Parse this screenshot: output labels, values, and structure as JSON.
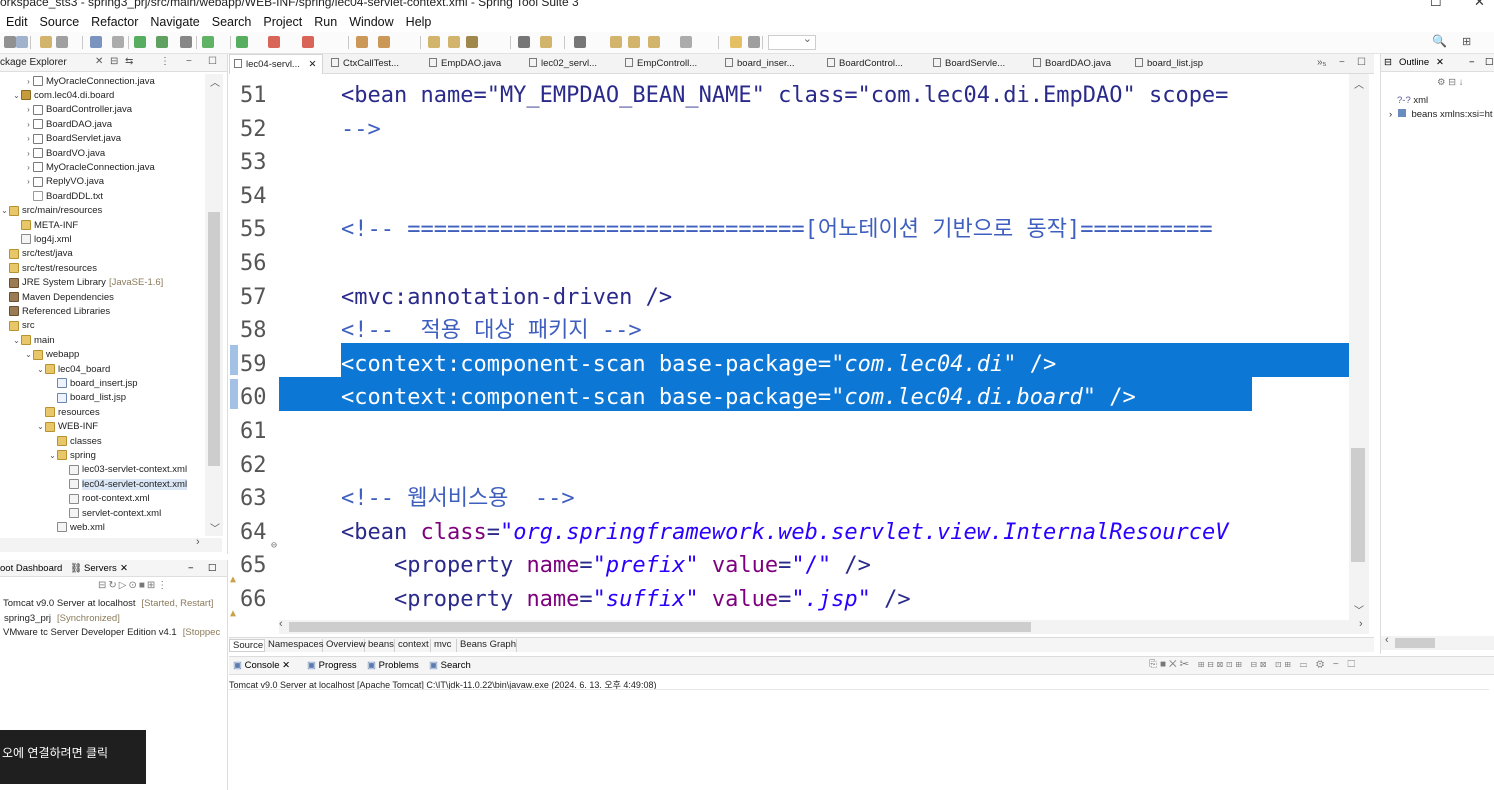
{
  "window": {
    "title": "orkspace_sts3 - spring3_prj/src/main/webapp/WEB-INF/spring/lec04-servlet-context.xml - Spring Tool Suite 3"
  },
  "menu": [
    "Edit",
    "Source",
    "Refactor",
    "Navigate",
    "Search",
    "Project",
    "Run",
    "Window",
    "Help"
  ],
  "package_explorer": {
    "title": "ckage Explorer",
    "items": [
      {
        "label": "MyOracleConnection.java",
        "indent": 3,
        "icon": "java-file-icon",
        "chev": "›"
      },
      {
        "label": "com.lec04.di.board",
        "indent": 2,
        "icon": "package-icon",
        "chev": "⌄"
      },
      {
        "label": "BoardController.java",
        "indent": 3,
        "icon": "java-file-icon",
        "chev": "›"
      },
      {
        "label": "BoardDAO.java",
        "indent": 3,
        "icon": "java-file-icon",
        "chev": "›"
      },
      {
        "label": "BoardServlet.java",
        "indent": 3,
        "icon": "java-file-icon",
        "chev": "›"
      },
      {
        "label": "BoardVO.java",
        "indent": 3,
        "icon": "java-file-icon",
        "chev": "›"
      },
      {
        "label": "MyOracleConnection.java",
        "indent": 3,
        "icon": "java-file-icon",
        "chev": "›"
      },
      {
        "label": "ReplyVO.java",
        "indent": 3,
        "icon": "java-file-icon",
        "chev": "›"
      },
      {
        "label": "BoardDDL.txt",
        "indent": 3,
        "icon": "text-file-icon",
        "chev": ""
      },
      {
        "label": "src/main/resources",
        "indent": 1,
        "icon": "source-folder-icon",
        "chev": "⌄"
      },
      {
        "label": "META-INF",
        "indent": 2,
        "icon": "folder-icon",
        "chev": ""
      },
      {
        "label": "log4j.xml",
        "indent": 2,
        "icon": "xml-file-icon",
        "chev": ""
      },
      {
        "label": "src/test/java",
        "indent": 1,
        "icon": "source-folder-icon",
        "chev": ""
      },
      {
        "label": "src/test/resources",
        "indent": 1,
        "icon": "source-folder-icon",
        "chev": ""
      },
      {
        "label": "JRE System Library",
        "deco": "[JavaSE-1.6]",
        "indent": 1,
        "icon": "library-icon",
        "chev": ""
      },
      {
        "label": "Maven Dependencies",
        "indent": 1,
        "icon": "library-icon",
        "chev": ""
      },
      {
        "label": "Referenced Libraries",
        "indent": 1,
        "icon": "library-icon",
        "chev": ""
      },
      {
        "label": "src",
        "indent": 1,
        "icon": "folder-icon",
        "chev": ""
      },
      {
        "label": "main",
        "indent": 2,
        "icon": "folder-icon",
        "chev": "⌄"
      },
      {
        "label": "webapp",
        "indent": 3,
        "icon": "folder-icon",
        "chev": "⌄"
      },
      {
        "label": "lec04_board",
        "indent": 4,
        "icon": "folder-icon",
        "chev": "⌄"
      },
      {
        "label": "board_insert.jsp",
        "indent": 5,
        "icon": "jsp-file-icon",
        "chev": ""
      },
      {
        "label": "board_list.jsp",
        "indent": 5,
        "icon": "jsp-file-icon",
        "chev": ""
      },
      {
        "label": "resources",
        "indent": 4,
        "icon": "folder-icon",
        "chev": ""
      },
      {
        "label": "WEB-INF",
        "indent": 4,
        "icon": "folder-icon",
        "chev": "⌄"
      },
      {
        "label": "classes",
        "indent": 5,
        "icon": "folder-icon",
        "chev": ""
      },
      {
        "label": "spring",
        "indent": 5,
        "icon": "folder-icon",
        "chev": "⌄"
      },
      {
        "label": "lec03-servlet-context.xml",
        "indent": 6,
        "icon": "xml-file-icon",
        "chev": ""
      },
      {
        "label": "lec04-servlet-context.xml",
        "indent": 6,
        "icon": "xml-file-icon",
        "chev": "",
        "selected": true
      },
      {
        "label": "root-context.xml",
        "indent": 6,
        "icon": "xml-file-icon",
        "chev": ""
      },
      {
        "label": "servlet-context.xml",
        "indent": 6,
        "icon": "xml-file-icon",
        "chev": ""
      },
      {
        "label": "web.xml",
        "indent": 5,
        "icon": "xml-file-icon",
        "chev": ""
      }
    ]
  },
  "servers_view": {
    "tab1": "oot Dashboard",
    "tab2": "Servers",
    "rows": [
      {
        "name": "Tomcat v9.0 Server at localhost",
        "state": "[Started, Restart]"
      },
      {
        "name": "spring3_prj",
        "state": "[Synchronized]"
      },
      {
        "name": "VMware tc Server Developer Edition v4.1",
        "state": "[Stoppec"
      }
    ]
  },
  "toast": {
    "text": "오에 연결하려면 클릭"
  },
  "editor": {
    "tabs": [
      "lec04-servl...",
      "CtxCallTest...",
      "EmpDAO.java",
      "lec02_servl...",
      "EmpControll...",
      "board_inser...",
      "BoardControl...",
      "BoardServle...",
      "BoardDAO.java",
      "board_list.jsp"
    ],
    "overflow": "»₅",
    "lines": [
      {
        "n": "51",
        "segs": [
          [
            "tag",
            "<bean name=\"MY_EMPDAO_BEAN_NAME\" class=\"com.lec04.di.EmpDAO\" scope="
          ]
        ]
      },
      {
        "n": "52",
        "segs": [
          [
            "comment",
            "-->"
          ]
        ]
      },
      {
        "n": "53",
        "segs": []
      },
      {
        "n": "54",
        "segs": []
      },
      {
        "n": "55",
        "segs": [
          [
            "comment",
            "<!-- ==============================[어노테이션 기반으로 동작]=========="
          ]
        ]
      },
      {
        "n": "56",
        "segs": []
      },
      {
        "n": "57",
        "segs": [
          [
            "tag",
            "<mvc:annotation-driven />"
          ]
        ]
      },
      {
        "n": "58",
        "segs": [
          [
            "comment",
            "<!--  적용 대상 패키지 -->"
          ]
        ]
      },
      {
        "n": "59",
        "segs": [
          [
            "tag",
            "<context:component-scan base-package="
          ],
          [
            "val",
            "\"com.lec04.di\""
          ],
          [
            "tag",
            " />"
          ]
        ]
      },
      {
        "n": "60",
        "segs": [
          [
            "tag",
            "<context:component-scan base-package="
          ],
          [
            "val",
            "\"com.lec04.di.board\""
          ],
          [
            "tag",
            " />"
          ]
        ]
      },
      {
        "n": "61",
        "segs": []
      },
      {
        "n": "62",
        "segs": []
      },
      {
        "n": "63",
        "segs": [
          [
            "comment",
            "<!-- 웹서비스용  -->"
          ]
        ]
      },
      {
        "n": "64",
        "segs": [
          [
            "tag",
            "<bean "
          ],
          [
            "attr",
            "class"
          ],
          [
            "tag",
            "="
          ],
          [
            "val",
            "\"org.springframework.web.servlet.view.InternalResourceV"
          ]
        ]
      },
      {
        "n": "65",
        "segs": [
          [
            "tag",
            "    <property "
          ],
          [
            "attr",
            "name"
          ],
          [
            "tag",
            "="
          ],
          [
            "val",
            "\"prefix\""
          ],
          [
            "tag",
            " "
          ],
          [
            "attr",
            "value"
          ],
          [
            "tag",
            "="
          ],
          [
            "valn",
            "\"/\""
          ],
          [
            "tag",
            " />"
          ]
        ]
      },
      {
        "n": "66",
        "segs": [
          [
            "tag",
            "    <property "
          ],
          [
            "attr",
            "name"
          ],
          [
            "tag",
            "="
          ],
          [
            "val",
            "\"suffix\""
          ],
          [
            "tag",
            " "
          ],
          [
            "attr",
            "value"
          ],
          [
            "tag",
            "="
          ],
          [
            "val",
            "\".jsp\""
          ],
          [
            "tag",
            " />"
          ]
        ]
      }
    ],
    "bottom_tabs": [
      "Source",
      "Namespaces",
      "Overview",
      "beans",
      "context",
      "mvc",
      "Beans Graph"
    ]
  },
  "outline": {
    "title": "Outline",
    "rows": [
      "xml",
      "beans xmlns:xsi=ht"
    ]
  },
  "console": {
    "tabs": [
      "Console",
      "Progress",
      "Problems",
      "Search"
    ],
    "path": "Tomcat v9.0 Server at localhost [Apache Tomcat] C:\\IT\\jdk-11.0.22\\bin\\javaw.exe  (2024. 6. 13. 오후 4:49:08)"
  },
  "colors": {
    "selection": "#0d77d6",
    "tag": "#2a2a8a",
    "attribute": "#7f007f",
    "string": "#2a00ff",
    "comment": "#3f5fbf"
  }
}
